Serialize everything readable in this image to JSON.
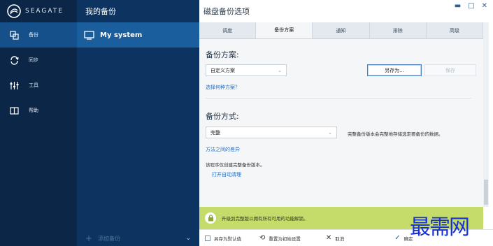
{
  "app": {
    "brand": "SEAGATE",
    "nav": [
      {
        "label": "备份",
        "icon": "copy-icon",
        "active": true
      },
      {
        "label": "同步",
        "icon": "sync-icon",
        "active": false
      },
      {
        "label": "工具",
        "icon": "tools-icon",
        "active": false
      },
      {
        "label": "帮助",
        "icon": "book-icon",
        "active": false
      }
    ]
  },
  "backups": {
    "header": "我的备份",
    "item": "My system",
    "add_label": "添加备份"
  },
  "dialog": {
    "title": "磁盘备份选项",
    "tabs": [
      "调度",
      "备份方案",
      "通知",
      "排除",
      "高级"
    ],
    "scheme_title": "备份方案:",
    "scheme_value": "自定义方案",
    "save_as": "另存为...",
    "save": "保存",
    "choose_link": "选择何种方案？",
    "method_title": "备份方式:",
    "method_value": "完整",
    "method_hint": "完整备份版本会完整地存储选定要备份的数据。",
    "difference_link": "方法之间的差异",
    "info_text": "该程序仅创建完整备份版本。",
    "cleanup_link": "打开自动清理",
    "banner": "升级到完整版以拥有所有可用的功能解锁。",
    "footer": {
      "save_default": "另存为默认值",
      "reset": "重置为初始设置",
      "cancel": "取消",
      "ok": "确定"
    }
  },
  "watermark": "最需网"
}
